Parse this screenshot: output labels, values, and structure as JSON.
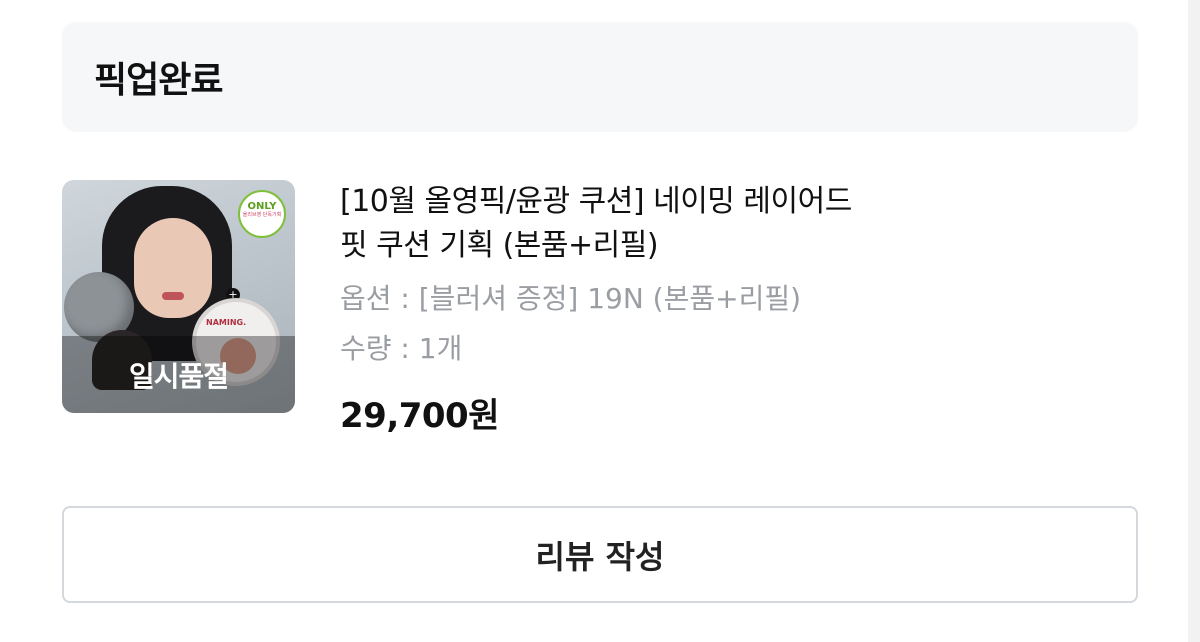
{
  "order_status": {
    "title": "픽업완료"
  },
  "product": {
    "title_line1": "[10월 올영픽/윤광 쿠션] 네이밍 레이어드",
    "title_line2": "핏 쿠션 기획 (본품+리필)",
    "option": "옵션 : [블러셔 증정] 19N (본품+리필)",
    "quantity": "수량 : 1개",
    "price": "29,700원",
    "thumbnail": {
      "overlay_text": "일시품절",
      "badge_top": "ONLY",
      "badge_bottom": "올리브영 단독기획",
      "refill_label": "NAMING."
    }
  },
  "actions": {
    "review_button": "리뷰 작성"
  },
  "colors": {
    "status_bg": "#f5f7f9",
    "muted_text": "#9a9ea3",
    "border": "#d4d7db"
  }
}
